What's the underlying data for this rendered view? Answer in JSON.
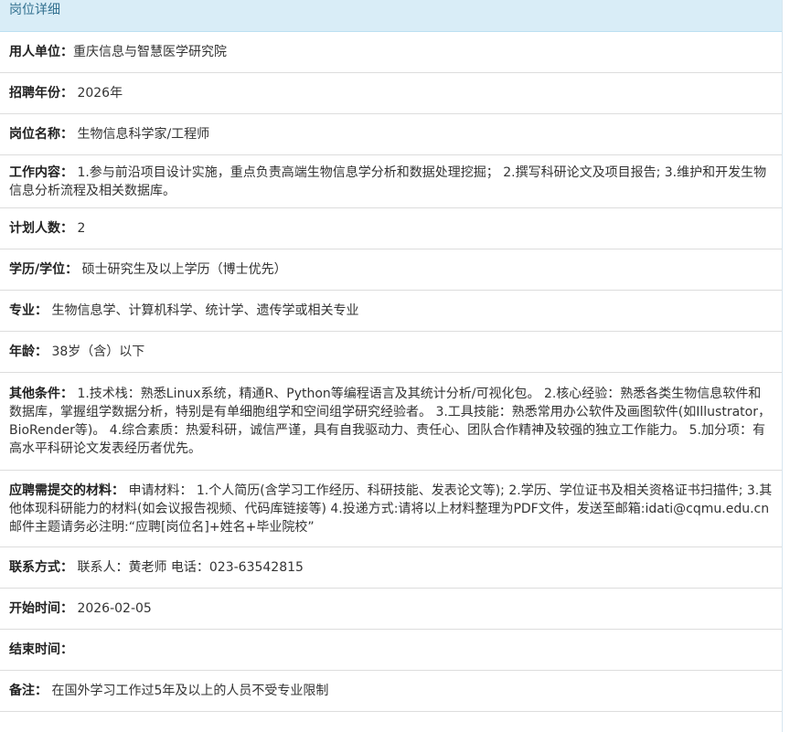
{
  "header": {
    "title": "岗位详细"
  },
  "fields": [
    {
      "label": "用人单位：",
      "value": "重庆信息与智慧医学研究院"
    },
    {
      "label": "招聘年份：",
      "value": " 2026年"
    },
    {
      "label": "岗位名称：",
      "value": " 生物信息科学家/工程师"
    },
    {
      "label": "工作内容：",
      "value": " 1.参与前沿项目设计实施，重点负责高端生物信息学分析和数据处理挖掘； 2.撰写科研论文及项目报告; 3.维护和开发生物信息分析流程及相关数据库。"
    },
    {
      "label": "计划人数：",
      "value": " 2"
    },
    {
      "label": "学历/学位：",
      "value": " 硕士研究生及以上学历（博士优先）"
    },
    {
      "label": "专业：",
      "value": " 生物信息学、计算机科学、统计学、遗传学或相关专业"
    },
    {
      "label": "年龄：",
      "value": " 38岁（含）以下"
    },
    {
      "label": "其他条件：",
      "value": " 1.技术栈：熟悉Linux系统，精通R、Python等编程语言及其统计分析/可视化包。 2.核心经验：熟悉各类生物信息软件和数据库，掌握组学数据分析，特别是有单细胞组学和空间组学研究经验者。 3.工具技能：熟悉常用办公软件及画图软件(如Illustrator，BioRender等)。 4.综合素质：热爱科研，诚信严谨，具有自我驱动力、责任心、团队合作精神及较强的独立工作能力。 5.加分项：有高水平科研论文发表经历者优先。"
    },
    {
      "label": "应聘需提交的材料：",
      "value": " 申请材料： 1.个人简历(含学习工作经历、科研技能、发表论文等); 2.学历、学位证书及相关资格证书扫描件; 3.其他体现科研能力的材料(如会议报告视频、代码库链接等) 4.投递方式:请将以上材料整理为PDF文件，发送至邮箱:idati@cqmu.edu.cn邮件主题请务必注明:“应聘[岗位名]+姓名+毕业院校”"
    },
    {
      "label": "联系方式：",
      "value": " 联系人：黄老师 电话：023-63542815"
    },
    {
      "label": "开始时间：",
      "value": " 2026-02-05"
    },
    {
      "label": "结束时间：",
      "value": ""
    },
    {
      "label": "备注：",
      "value": " 在国外学习工作过5年及以上的人员不受专业限制"
    }
  ]
}
